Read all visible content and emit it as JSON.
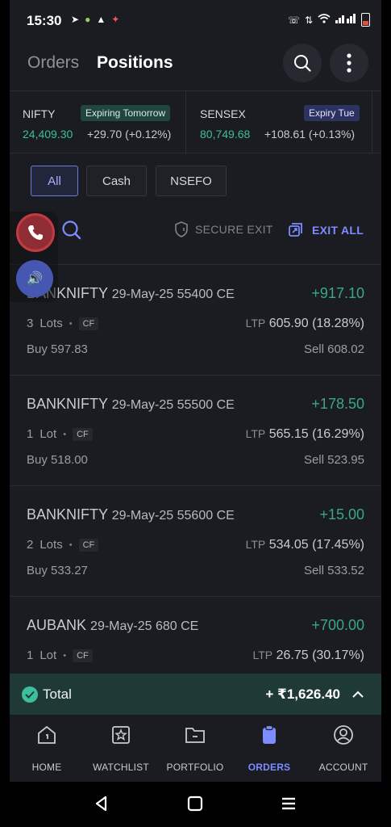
{
  "status_bar": {
    "time": "15:30"
  },
  "header": {
    "tab_orders": "Orders",
    "tab_positions": "Positions"
  },
  "indices": [
    {
      "name": "NIFTY",
      "badge": "Expiring Tomorrow",
      "value": "24,409.30",
      "change": "+29.70 (+0.12%)"
    },
    {
      "name": "SENSEX",
      "badge": "Expiry Tue",
      "value": "80,749.68",
      "change": "+108.61 (+0.13%)"
    }
  ],
  "filters": {
    "all": "All",
    "cash": "Cash",
    "nsefo": "NSEFO"
  },
  "actions": {
    "secure_exit": "SECURE EXIT",
    "exit_all": "EXIT ALL"
  },
  "positions": [
    {
      "symbol": "BANKNIFTY",
      "detail": "29-May-25 55400 CE",
      "pnl": "+917.10",
      "qty_num": "3",
      "qty_unit": "Lots",
      "cf": "CF",
      "ltp_label": "LTP",
      "ltp": "605.90 (18.28%)",
      "buy": "Buy 597.83",
      "sell": "Sell 608.02"
    },
    {
      "symbol": "BANKNIFTY",
      "detail": "29-May-25 55500 CE",
      "pnl": "+178.50",
      "qty_num": "1",
      "qty_unit": "Lot",
      "cf": "CF",
      "ltp_label": "LTP",
      "ltp": "565.15 (16.29%)",
      "buy": "Buy 518.00",
      "sell": "Sell 523.95"
    },
    {
      "symbol": "BANKNIFTY",
      "detail": "29-May-25 55600 CE",
      "pnl": "+15.00",
      "qty_num": "2",
      "qty_unit": "Lots",
      "cf": "CF",
      "ltp_label": "LTP",
      "ltp": "534.05 (17.45%)",
      "buy": "Buy 533.27",
      "sell": "Sell 533.52"
    },
    {
      "symbol": "AUBANK",
      "detail": "29-May-25 680 CE",
      "pnl": "+700.00",
      "qty_num": "1",
      "qty_unit": "Lot",
      "cf": "CF",
      "ltp_label": "LTP",
      "ltp": "26.75 (30.17%)",
      "buy": "",
      "sell": ""
    }
  ],
  "total": {
    "label": "Total",
    "value": "+ ₹1,626.40"
  },
  "nav": {
    "home": "HOME",
    "watchlist": "WATCHLIST",
    "portfolio": "PORTFOLIO",
    "orders": "ORDERS",
    "account": "ACCOUNT"
  },
  "colors": {
    "profit": "#3aa886",
    "accent": "#7d8cff",
    "total_bg": "#1f3a36"
  }
}
